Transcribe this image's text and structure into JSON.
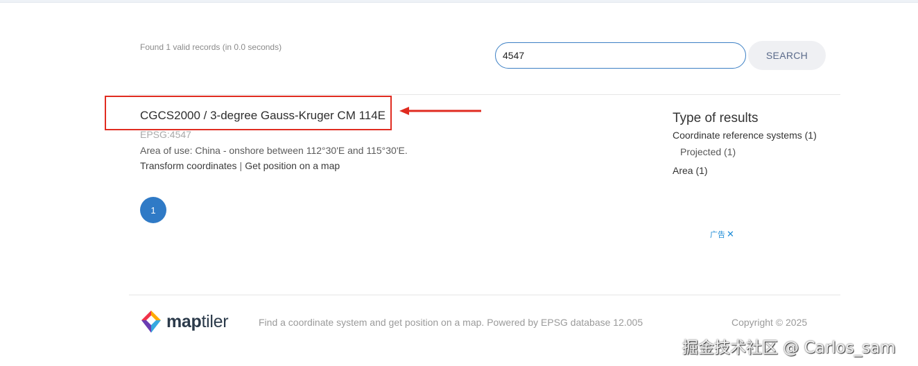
{
  "results_header": {
    "found_text": "Found 1 valid records (in 0.0 seconds)"
  },
  "search": {
    "value": "4547",
    "button_label": "SEARCH"
  },
  "result": {
    "title": "CGCS2000 / 3-degree Gauss-Kruger CM 114E",
    "code": "EPSG:4547",
    "area_of_use": "Area of use: China - onshore between 112°30'E and 115°30'E.",
    "link_transform": "Transform coordinates",
    "link_separator": "|",
    "link_map": "Get position on a map"
  },
  "pagination": {
    "current_page": "1"
  },
  "facets": {
    "title": "Type of results",
    "crs": "Coordinate reference systems (1)",
    "projected": "Projected (1)",
    "area": "Area (1)"
  },
  "ad": {
    "label": "广告",
    "close": "✕"
  },
  "footer": {
    "logo_text_bold": "map",
    "logo_text_light": "tiler",
    "tagline": "Find a coordinate system and get position on a map. Powered by EPSG database 12.005",
    "copyright": "Copyright © 2025"
  },
  "watermark": "掘金技术社区 @ Carlos_sam",
  "colors": {
    "accent": "#2f7ac6",
    "annotation": "#e02b20",
    "ad": "#1a8ad6"
  }
}
